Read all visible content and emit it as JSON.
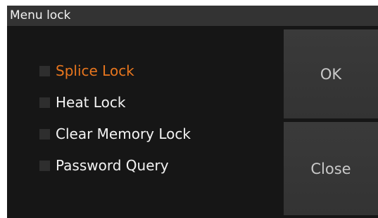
{
  "dialog": {
    "title": "Menu lock"
  },
  "options": [
    {
      "label": "Splice Lock",
      "checked": false,
      "highlighted": true
    },
    {
      "label": "Heat Lock",
      "checked": false,
      "highlighted": false
    },
    {
      "label": "Clear Memory Lock",
      "checked": false,
      "highlighted": false
    },
    {
      "label": "Password Query",
      "checked": false,
      "highlighted": false
    }
  ],
  "buttons": {
    "ok_label": "OK",
    "close_label": "Close"
  },
  "colors": {
    "highlight": "#e8761e",
    "background": "#161616",
    "titlebar": "#333333",
    "button": "#383838"
  }
}
